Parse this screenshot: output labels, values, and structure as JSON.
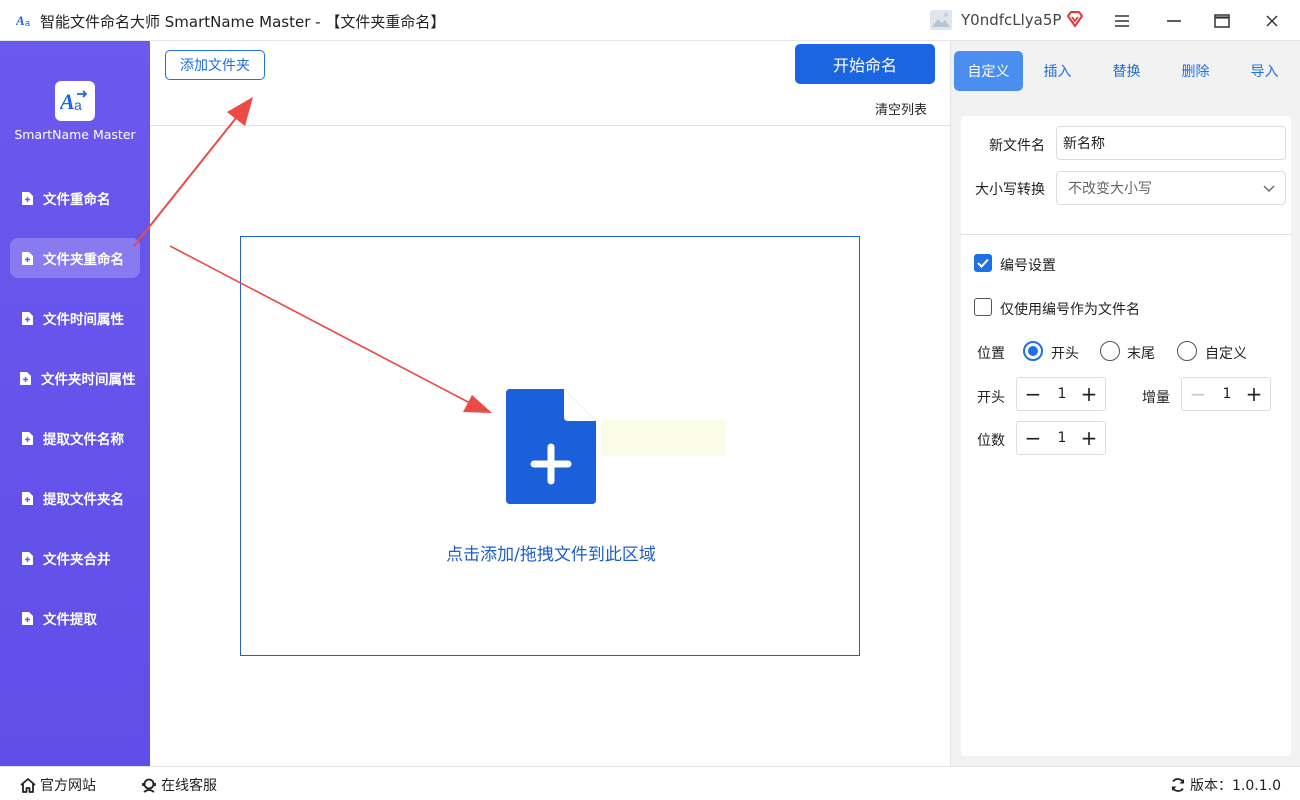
{
  "window": {
    "title": "智能文件命名大师 SmartName Master - 【文件夹重命名】",
    "username": "Y0ndfcLlya5P"
  },
  "sidebar": {
    "logo_text": "SmartName Master",
    "items": [
      {
        "label": "文件重命名"
      },
      {
        "label": "文件夹重命名"
      },
      {
        "label": "文件时间属性"
      },
      {
        "label": "文件夹时间属性"
      },
      {
        "label": "提取文件名称"
      },
      {
        "label": "提取文件夹名"
      },
      {
        "label": "文件夹合并"
      },
      {
        "label": "文件提取"
      }
    ]
  },
  "toolbar": {
    "add_folder_label": "添加文件夹",
    "start_label": "开始命名",
    "clear_label": "清空列表"
  },
  "dropzone": {
    "text": "点击添加/拖拽文件到此区域"
  },
  "panel": {
    "tabs": [
      {
        "label": "自定义",
        "active": true
      },
      {
        "label": "插入",
        "active": false
      },
      {
        "label": "替换",
        "active": false
      },
      {
        "label": "删除",
        "active": false
      },
      {
        "label": "导入",
        "active": false
      }
    ],
    "new_name_label": "新文件名",
    "new_name_value": "新名称",
    "case_label": "大小写转换",
    "case_value": "不改变大小写",
    "numbering_label": "编号设置",
    "numbering_checked": true,
    "only_number_label": "仅使用编号作为文件名",
    "only_number_checked": false,
    "position_label": "位置",
    "position_options": [
      "开头",
      "末尾",
      "自定义"
    ],
    "position_selected": "开头",
    "start_label": "开头",
    "start_value": "1",
    "increment_label": "增量",
    "increment_value": "1",
    "digits_label": "位数",
    "digits_value": "1"
  },
  "statusbar": {
    "website_label": "官方网站",
    "support_label": "在线客服",
    "version_label": "版本：1.0.1.0"
  },
  "colors": {
    "sidebar": "#6b58ee",
    "accent": "#1b66e0",
    "annotation_arrow": "#ec4a45"
  }
}
